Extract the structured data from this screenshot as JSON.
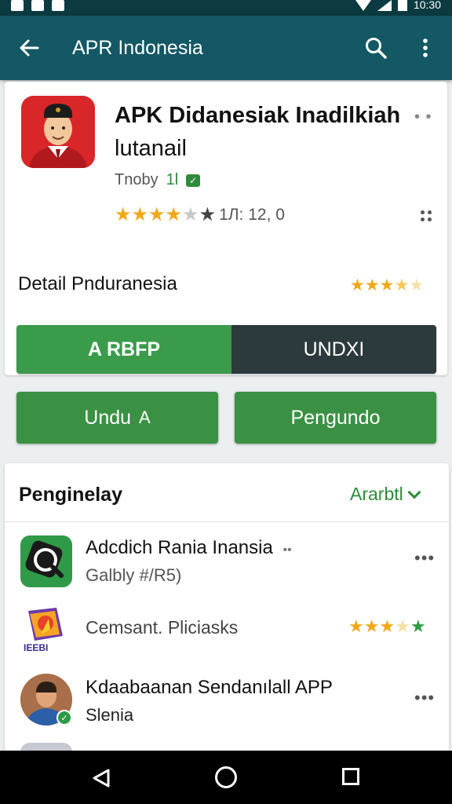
{
  "status_bar": {
    "time": "10:30"
  },
  "app_bar": {
    "title": "APR Indonesia"
  },
  "app": {
    "title_line1": "APK Didanesiak Inadilkiah",
    "title_line2": "lutanail",
    "developer": "Tnoby",
    "developer_badge": "1l",
    "rating_count": "1Л: 12, 0",
    "card_menu": "• •"
  },
  "detail": {
    "title": "Detail Pnduranesia"
  },
  "segment": {
    "left_label": "RBFP",
    "left_icon": "A",
    "right_label": "UNDXI"
  },
  "buttons": {
    "left": "Undu",
    "left_icon": "A",
    "right": "Pengundo"
  },
  "list": {
    "header": "Penginelay",
    "filter": "Ararbtl",
    "items": [
      {
        "title": "Adcdich Rania Inansia",
        "title_suffix": "••",
        "subtitle": "Galbly #/R5)"
      },
      {
        "title": "Cemsant. Pliciasks",
        "icon_text": "IEEBI"
      },
      {
        "title": "Kdaabaanan Sendanılall APP",
        "subtitle": "Slenia"
      }
    ]
  },
  "colors": {
    "appbar": "#135864",
    "primary_green": "#3a9143",
    "dark_segment": "#2c3a3d",
    "star": "#f1a817"
  }
}
